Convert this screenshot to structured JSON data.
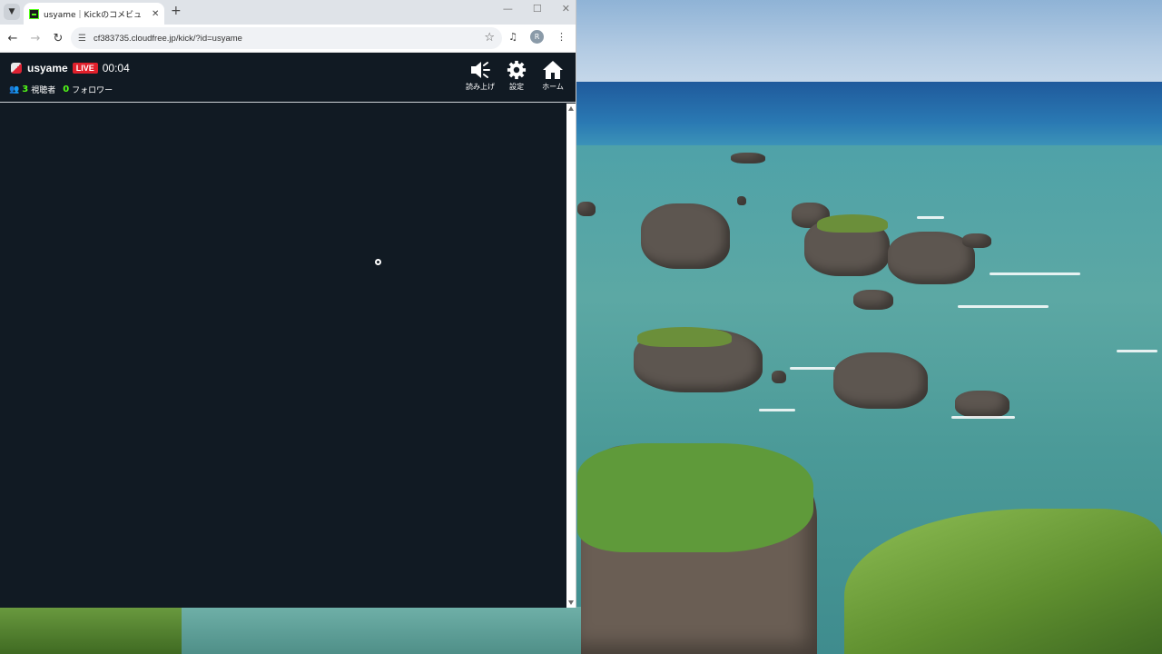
{
  "browser": {
    "tab_title": "usyame｜Kickのコメビュ",
    "url": "cf383735.cloudfree.jp/kick/?id=usyame",
    "profile_initial": "R"
  },
  "stream": {
    "streamer_name": "usyame",
    "live_label": "LIVE",
    "elapsed": "00:04",
    "viewers_count": "3",
    "viewers_label": "視聴者",
    "followers_count": "0",
    "followers_label": "フォロワー"
  },
  "actions": {
    "read_aloud": "読み上げ",
    "settings": "設定",
    "home": "ホーム"
  },
  "colors": {
    "page_bg": "#111a23",
    "live_red": "#e0202b",
    "kick_green": "#53fc18"
  }
}
